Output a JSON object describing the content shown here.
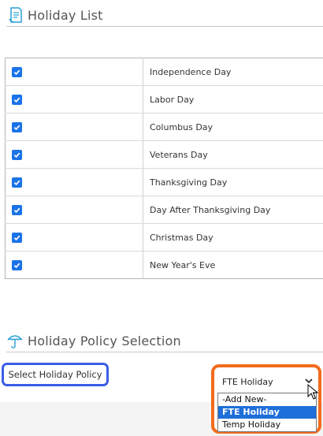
{
  "holiday_list": {
    "title": "Holiday List",
    "rows": [
      {
        "checked": true,
        "name": "Independence Day"
      },
      {
        "checked": true,
        "name": "Labor Day"
      },
      {
        "checked": true,
        "name": "Columbus Day"
      },
      {
        "checked": true,
        "name": "Veterans Day"
      },
      {
        "checked": true,
        "name": "Thanksgiving Day"
      },
      {
        "checked": true,
        "name": "Day After Thanksgiving Day"
      },
      {
        "checked": true,
        "name": "Christmas Day"
      },
      {
        "checked": true,
        "name": "New Year's Eve"
      }
    ]
  },
  "policy": {
    "title": "Holiday Policy Selection",
    "select_label": "Select Holiday Policy",
    "selected_value": "FTE Holiday",
    "options": [
      "-Add New-",
      "FTE Holiday",
      "Temp Holiday"
    ],
    "highlighted_option": "FTE Holiday"
  },
  "colors": {
    "checkbox": "#1a73e8",
    "label_highlight": "#3a5de8",
    "dropdown_highlight": "#f26b1d",
    "selected_option_bg": "#1e6fd9"
  }
}
